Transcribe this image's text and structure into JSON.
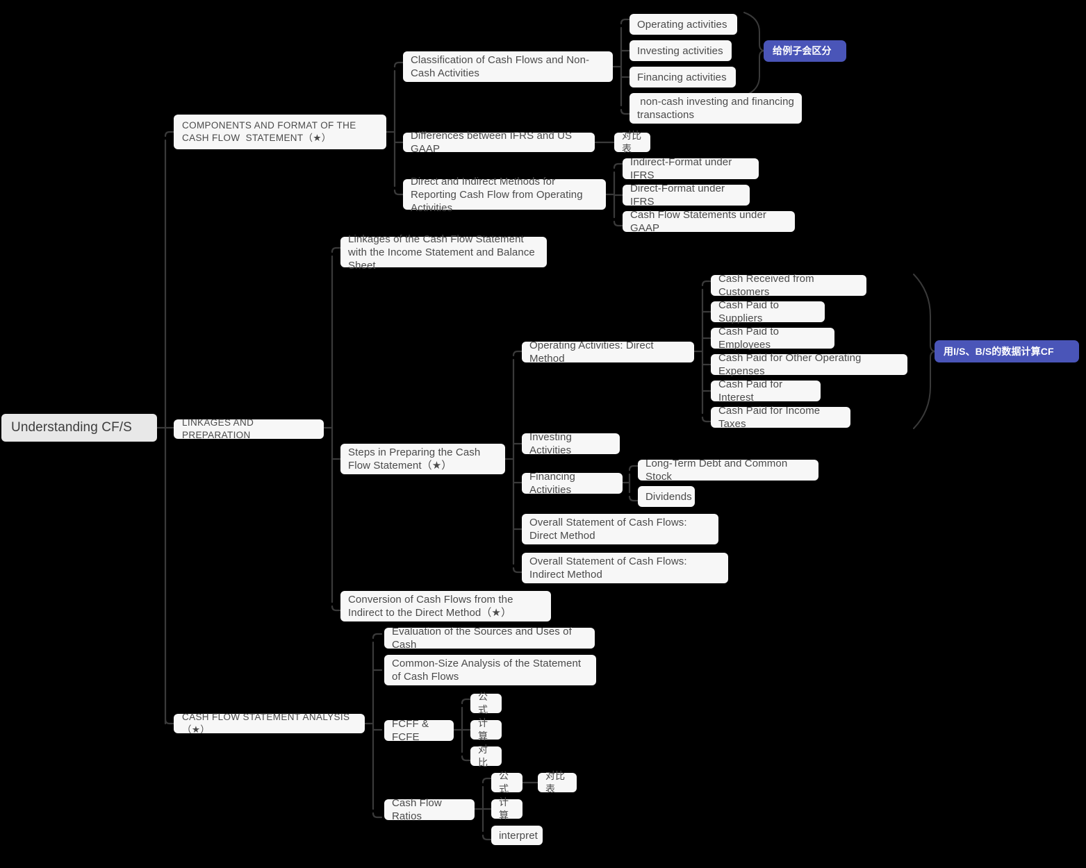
{
  "title": "Understanding CF/S",
  "colors": {
    "background": "#000000",
    "node_bg": "#f7f7f7",
    "root_bg": "#e8e8e8",
    "text": "#4a4a4a",
    "accent_bg": "#4a55b8",
    "accent_text": "#ffffff",
    "link": "#3a3a3a"
  },
  "nodes": {
    "root": "Understanding CF/S",
    "b1": "COMPONENTS AND FORMAT OF THE CASH FLOW  STATEMENT（★）",
    "b1c1": "Classification of Cash Flows and Non-Cash Activities",
    "b1c1g1": "Operating activities",
    "b1c1g2": "Investing activities",
    "b1c1g3": "Financing activities",
    "b1c1g4": " non-cash investing and financing transactions",
    "b1c1summary": "给例子会区分",
    "b1c2": "Differences between IFRS and US GAAP",
    "b1c2g1": "对比表",
    "b1c3": "Direct and Indirect Methods for Reporting Cash Flow from Operating Activities",
    "b1c3g1": "Indirect-Format under IFRS",
    "b1c3g2": "Direct-Format under IFRS",
    "b1c3g3": "Cash Flow Statements under GAAP",
    "b2": "LINKAGES AND PREPARATION",
    "b2c1": "Linkages of the Cash Flow Statement with the Income Statement and Balance Sheet",
    "b2c2": "Steps in Preparing the Cash Flow Statement（★）",
    "b2c2g1": "Operating Activities: Direct Method",
    "b2c2g1s1": "Cash Received from Customers",
    "b2c2g1s2": "Cash Paid to Suppliers",
    "b2c2g1s3": "Cash Paid to Employees",
    "b2c2g1s4": "Cash Paid for Other Operating Expenses",
    "b2c2g1s5": "Cash Paid for Interest",
    "b2c2g1s6": "Cash Paid for Income Taxes",
    "b2c2g1summary": "用I/S、B/S的数据计算CF",
    "b2c2g2": "Investing Activities",
    "b2c2g3": "Financing Activities",
    "b2c2g3s1": "Long-Term Debt and Common Stock",
    "b2c2g3s2": "Dividends",
    "b2c2g4": "Overall Statement of Cash Flows: Direct Method",
    "b2c2g5": "Overall Statement of Cash Flows: Indirect Method",
    "b2c3": "Conversion of Cash Flows from the Indirect to the Direct Method（★）",
    "b3": "CASH FLOW STATEMENT ANALYSIS（★）",
    "b3c1": "Evaluation of the Sources and Uses of Cash",
    "b3c2": "Common-Size Analysis of the Statement of Cash Flows",
    "b3c3": "FCFF & FCFE",
    "b3c3g1": "公式",
    "b3c3g2": "计算",
    "b3c3g3": "对比",
    "b3c4": "Cash Flow Ratios",
    "b3c4g1": "公式",
    "b3c4g1s1": "对比表",
    "b3c4g2": "计算",
    "b3c4g3": "interpret"
  }
}
